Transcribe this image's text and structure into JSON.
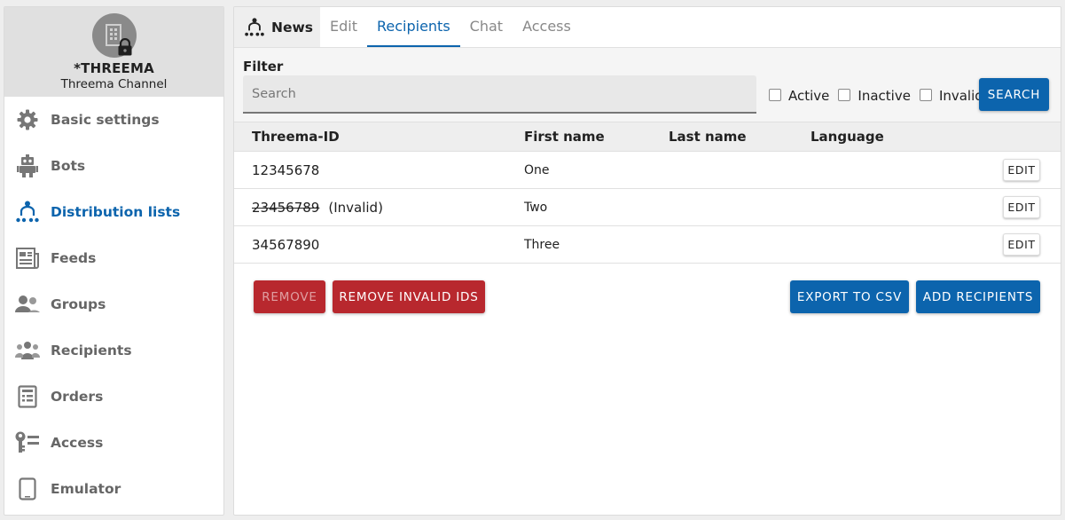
{
  "profile": {
    "name": "*THREEMA",
    "subtitle": "Threema Channel",
    "icon": "building-lock-icon"
  },
  "sidebar": {
    "items": [
      {
        "label": "Basic settings",
        "icon": "gear-icon"
      },
      {
        "label": "Bots",
        "icon": "robot-icon"
      },
      {
        "label": "Distribution lists",
        "icon": "distribution-icon",
        "active": true
      },
      {
        "label": "Feeds",
        "icon": "feed-icon"
      },
      {
        "label": "Groups",
        "icon": "groups-icon"
      },
      {
        "label": "Recipients",
        "icon": "recipients-icon"
      },
      {
        "label": "Orders",
        "icon": "orders-icon"
      },
      {
        "label": "Access",
        "icon": "key-icon"
      },
      {
        "label": "Emulator",
        "icon": "phone-icon"
      }
    ]
  },
  "header": {
    "title": "News",
    "tabs": [
      {
        "label": "Edit"
      },
      {
        "label": "Recipients",
        "active": true
      },
      {
        "label": "Chat"
      },
      {
        "label": "Access"
      }
    ]
  },
  "filter": {
    "label": "Filter",
    "search_placeholder": "Search",
    "search_value": "",
    "checkboxes": [
      {
        "label": "Active",
        "checked": false
      },
      {
        "label": "Inactive",
        "checked": false
      },
      {
        "label": "Invalid",
        "checked": false
      }
    ],
    "search_button": "SEARCH"
  },
  "table": {
    "columns": [
      "Threema-ID",
      "First name",
      "Last name",
      "Language"
    ],
    "rows": [
      {
        "id": "12345678",
        "invalid": false,
        "invalid_label": "",
        "first_name": "One",
        "last_name": "",
        "language": "",
        "edit": "EDIT"
      },
      {
        "id": "23456789",
        "invalid": true,
        "invalid_label": "(Invalid)",
        "first_name": "Two",
        "last_name": "",
        "language": "",
        "edit": "EDIT"
      },
      {
        "id": "34567890",
        "invalid": false,
        "invalid_label": "",
        "first_name": "Three",
        "last_name": "",
        "language": "",
        "edit": "EDIT"
      }
    ]
  },
  "actions": {
    "remove": "REMOVE",
    "remove_invalid": "REMOVE INVALID IDS",
    "export_csv": "EXPORT TO CSV",
    "add_recipients": "ADD RECIPIENTS"
  },
  "colors": {
    "accent": "#0c64ad",
    "danger": "#b8282e",
    "icon_gray": "#777777"
  }
}
